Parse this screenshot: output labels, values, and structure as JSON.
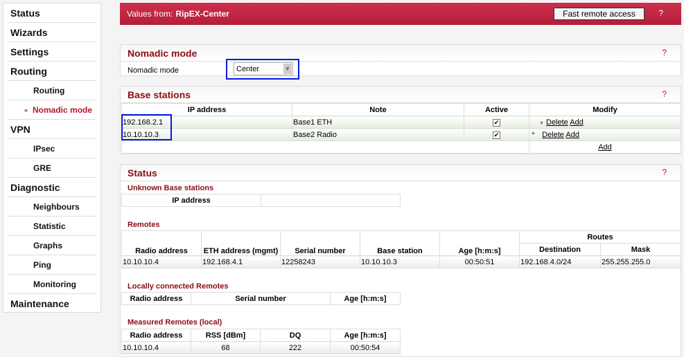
{
  "sidebar": {
    "items": [
      {
        "label": "Status",
        "level": "top"
      },
      {
        "label": "Wizards",
        "level": "top"
      },
      {
        "label": "Settings",
        "level": "top"
      },
      {
        "label": "Routing",
        "level": "top"
      },
      {
        "label": "Routing",
        "level": "sub"
      },
      {
        "label": "Nomadic mode",
        "level": "sub",
        "active": true
      },
      {
        "label": "VPN",
        "level": "top"
      },
      {
        "label": "IPsec",
        "level": "sub"
      },
      {
        "label": "GRE",
        "level": "sub"
      },
      {
        "label": "Diagnostic",
        "level": "top"
      },
      {
        "label": "Neighbours",
        "level": "sub"
      },
      {
        "label": "Statistic",
        "level": "sub"
      },
      {
        "label": "Graphs",
        "level": "sub"
      },
      {
        "label": "Ping",
        "level": "sub"
      },
      {
        "label": "Monitoring",
        "level": "sub"
      },
      {
        "label": "Maintenance",
        "level": "top"
      }
    ],
    "active_marker": "»"
  },
  "header": {
    "prefix": "Values from:",
    "device": "RipEX-Center",
    "fast_remote": "Fast remote access",
    "help": "?"
  },
  "nomadic": {
    "title": "Nomadic mode",
    "help": "?",
    "label": "Nomadic mode",
    "value": "Center"
  },
  "base": {
    "title": "Base stations",
    "help": "?",
    "cols": [
      "IP address",
      "Note",
      "Active",
      "Modify"
    ],
    "rows": [
      {
        "ip": "192.168.2.1",
        "note": "Base1 ETH",
        "active": "✔",
        "delete": "Delete",
        "add": "Add"
      },
      {
        "ip": "10.10.10.3",
        "note": "Base2 Radio",
        "active": "✔",
        "delete": "Delete",
        "add": "Add"
      }
    ],
    "add": "Add"
  },
  "status": {
    "title": "Status",
    "help": "?",
    "unknown": {
      "title": "Unknown Base stations",
      "cols": [
        "IP address"
      ]
    },
    "remotes": {
      "title": "Remotes",
      "cols": [
        "Radio address",
        "ETH address (mgmt)",
        "Serial number",
        "Base station",
        "Age [h:m:s]",
        "Routes",
        "Destination",
        "Mask"
      ],
      "row": [
        "10.10.10.4",
        "192.168.4.1",
        "12258243",
        "10.10.10.3",
        "00:50:51",
        "192.168.4.0/24",
        "255.255.255.0"
      ]
    },
    "local": {
      "title": "Locally connected Remotes",
      "cols": [
        "Radio address",
        "Serial number",
        "Age [h:m:s]"
      ]
    },
    "measured": {
      "title": "Measured Remotes (local)",
      "cols": [
        "Radio address",
        "RSS [dBm]",
        "DQ",
        "Age [h:m:s]"
      ],
      "row": [
        "10.10.10.4",
        "68",
        "222",
        "00:50:54"
      ]
    }
  },
  "colors": {
    "accent": "#c0223f",
    "title": "#8b0d14",
    "highlight": "#0019e6"
  }
}
